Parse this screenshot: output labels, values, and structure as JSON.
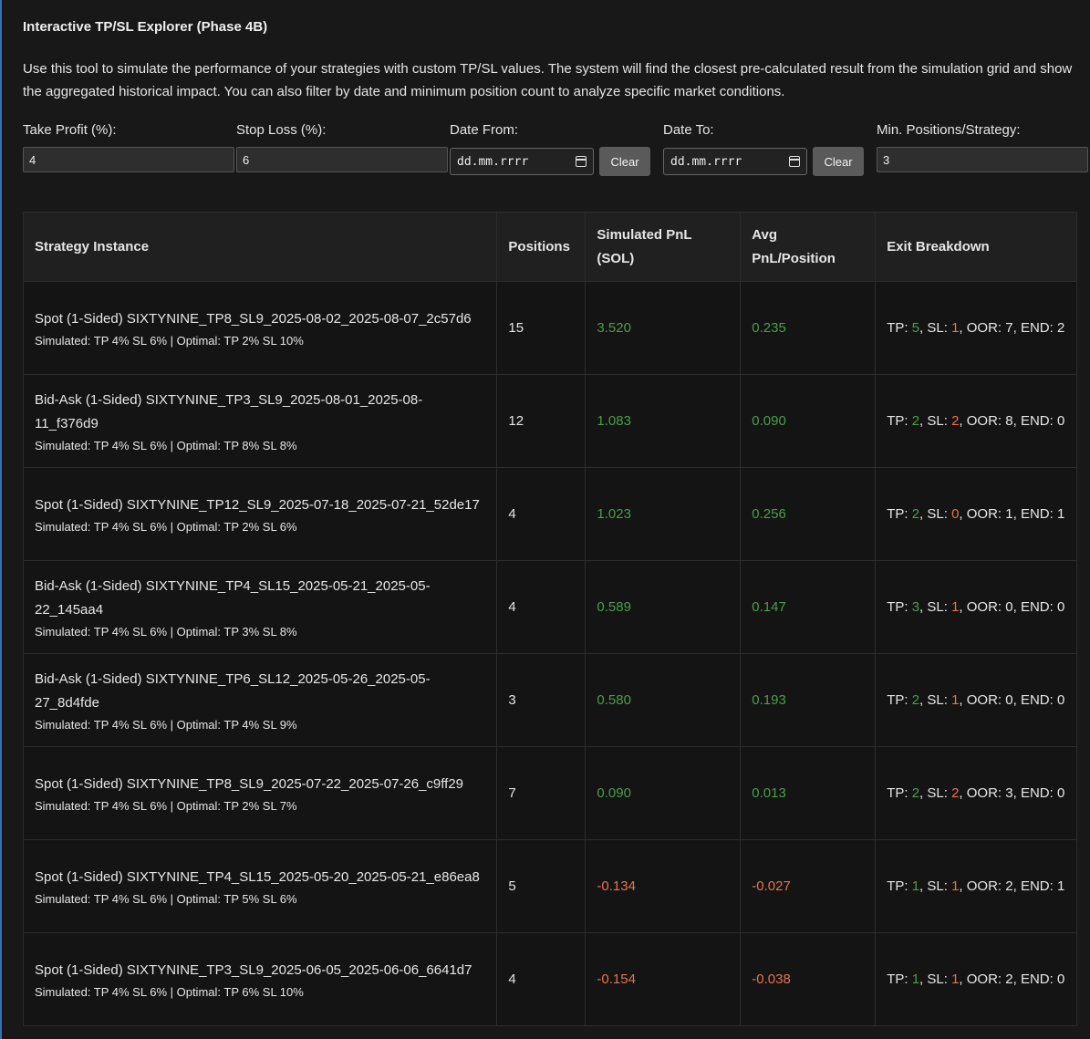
{
  "title": "Interactive TP/SL Explorer (Phase 4B)",
  "description": "Use this tool to simulate the performance of your strategies with custom TP/SL values. The system will find the closest pre-calculated result from the simulation grid and show the aggregated historical impact. You can also filter by date and minimum position count to analyze specific market conditions.",
  "controls": {
    "take_profit": {
      "label": "Take Profit (%):",
      "value": "4"
    },
    "stop_loss": {
      "label": "Stop Loss (%):",
      "value": "6"
    },
    "date_from": {
      "label": "Date From:",
      "placeholder": "dd.mm.rrrr",
      "clear_label": "Clear"
    },
    "date_to": {
      "label": "Date To:",
      "placeholder": "dd.mm.rrrr",
      "clear_label": "Clear"
    },
    "min_positions": {
      "label": "Min. Positions/Strategy:",
      "value": "3"
    }
  },
  "table": {
    "headers": [
      "Strategy Instance",
      "Positions",
      "Simulated PnL (SOL)",
      "Avg PnL/Position",
      "Exit Breakdown"
    ],
    "rows": [
      {
        "name": "Spot (1-Sided) SIXTYNINE_TP8_SL9_2025-08-02_2025-08-07_2c57d6",
        "sub": "Simulated: TP 4% SL 6% | Optimal: TP 2% SL 10%",
        "positions": "15",
        "pnl": "3.520",
        "avg": "0.235",
        "tp": "5",
        "sl": "1",
        "oor": "7",
        "end": "2",
        "sign": "pos"
      },
      {
        "name": "Bid-Ask (1-Sided) SIXTYNINE_TP3_SL9_2025-08-01_2025-08-11_f376d9",
        "sub": "Simulated: TP 4% SL 6% | Optimal: TP 8% SL 8%",
        "positions": "12",
        "pnl": "1.083",
        "avg": "0.090",
        "tp": "2",
        "sl": "2",
        "oor": "8",
        "end": "0",
        "sign": "pos"
      },
      {
        "name": "Spot (1-Sided) SIXTYNINE_TP12_SL9_2025-07-18_2025-07-21_52de17",
        "sub": "Simulated: TP 4% SL 6% | Optimal: TP 2% SL 6%",
        "positions": "4",
        "pnl": "1.023",
        "avg": "0.256",
        "tp": "2",
        "sl": "0",
        "oor": "1",
        "end": "1",
        "sign": "pos"
      },
      {
        "name": "Bid-Ask (1-Sided) SIXTYNINE_TP4_SL15_2025-05-21_2025-05-22_145aa4",
        "sub": "Simulated: TP 4% SL 6% | Optimal: TP 3% SL 8%",
        "positions": "4",
        "pnl": "0.589",
        "avg": "0.147",
        "tp": "3",
        "sl": "1",
        "oor": "0",
        "end": "0",
        "sign": "pos"
      },
      {
        "name": "Bid-Ask (1-Sided) SIXTYNINE_TP6_SL12_2025-05-26_2025-05-27_8d4fde",
        "sub": "Simulated: TP 4% SL 6% | Optimal: TP 4% SL 9%",
        "positions": "3",
        "pnl": "0.580",
        "avg": "0.193",
        "tp": "2",
        "sl": "1",
        "oor": "0",
        "end": "0",
        "sign": "pos"
      },
      {
        "name": "Spot (1-Sided) SIXTYNINE_TP8_SL9_2025-07-22_2025-07-26_c9ff29",
        "sub": "Simulated: TP 4% SL 6% | Optimal: TP 2% SL 7%",
        "positions": "7",
        "pnl": "0.090",
        "avg": "0.013",
        "tp": "2",
        "sl": "2",
        "oor": "3",
        "end": "0",
        "sign": "pos"
      },
      {
        "name": "Spot (1-Sided) SIXTYNINE_TP4_SL15_2025-05-20_2025-05-21_e86ea8",
        "sub": "Simulated: TP 4% SL 6% | Optimal: TP 5% SL 6%",
        "positions": "5",
        "pnl": "-0.134",
        "avg": "-0.027",
        "tp": "1",
        "sl": "1",
        "oor": "2",
        "end": "1",
        "sign": "neg"
      },
      {
        "name": "Spot (1-Sided) SIXTYNINE_TP3_SL9_2025-06-05_2025-06-06_6641d7",
        "sub": "Simulated: TP 4% SL 6% | Optimal: TP 6% SL 10%",
        "positions": "4",
        "pnl": "-0.154",
        "avg": "-0.038",
        "tp": "1",
        "sl": "1",
        "oor": "2",
        "end": "0",
        "sign": "neg"
      }
    ]
  },
  "colors": {
    "positive": "#4a9e4a",
    "negative": "#e8734a",
    "accent_rule": "#3b6fb0"
  }
}
